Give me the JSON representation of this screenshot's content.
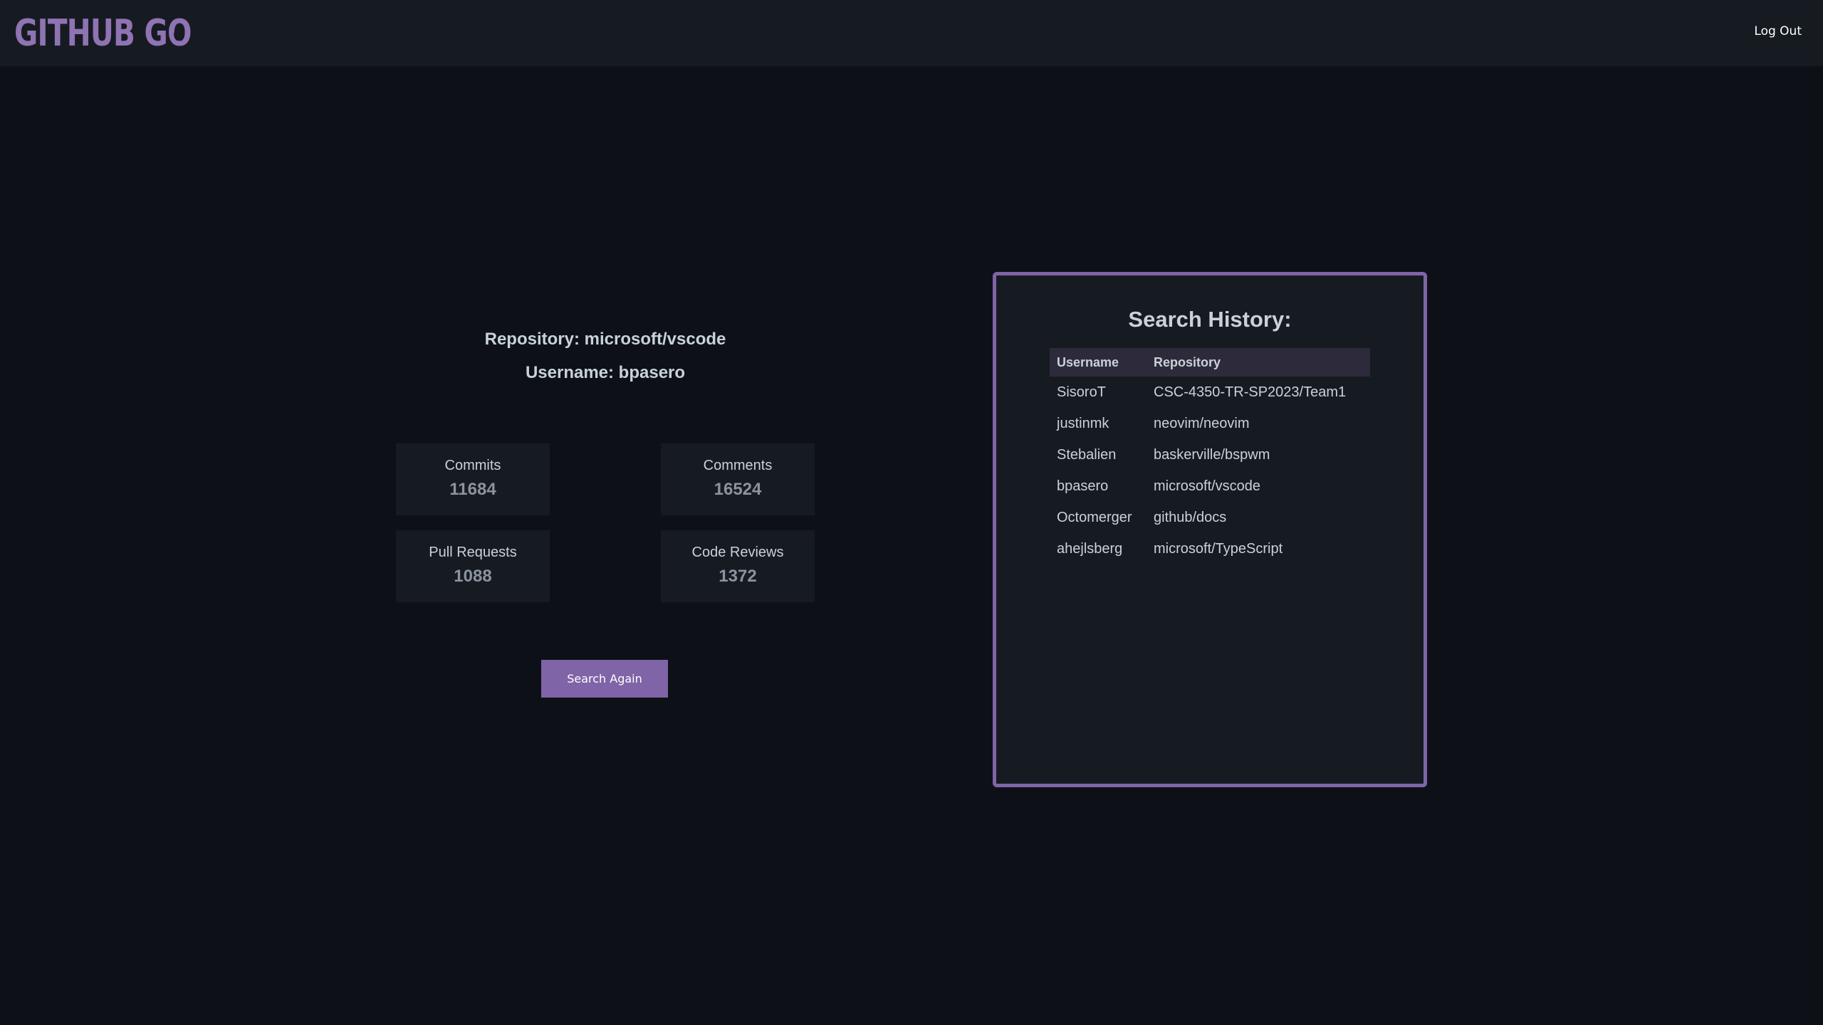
{
  "header": {
    "logo": {
      "text_before": "GITHUB G",
      "icon": "octocat-icon"
    },
    "logout_label": "Log Out"
  },
  "result": {
    "repository": "Repository: microsoft/vscode",
    "username": "Username: bpasero"
  },
  "stats": [
    {
      "label": "Commits",
      "value": "11684"
    },
    {
      "label": "Comments",
      "value": "16524"
    },
    {
      "label": "Pull Requests",
      "value": "1088"
    },
    {
      "label": "Code Reviews",
      "value": "1372"
    }
  ],
  "search_again_label": "Search Again",
  "history": {
    "title": "Search History:",
    "columns": [
      "Username",
      "Repository"
    ],
    "rows": [
      [
        "SisoroT",
        "CSC-4350-TR-SP2023/Team1"
      ],
      [
        "justinmk",
        "neovim/neovim"
      ],
      [
        "Stebalien",
        "baskerville/bspwm"
      ],
      [
        "bpasero",
        "microsoft/vscode"
      ],
      [
        "Octomerger",
        "github/docs"
      ],
      [
        "ahejlsberg",
        "microsoft/TypeScript"
      ]
    ]
  },
  "colors": {
    "accent": "#8064a8",
    "logo": "#8f73b3",
    "background": "#0d1117",
    "panel": "#161b22"
  }
}
